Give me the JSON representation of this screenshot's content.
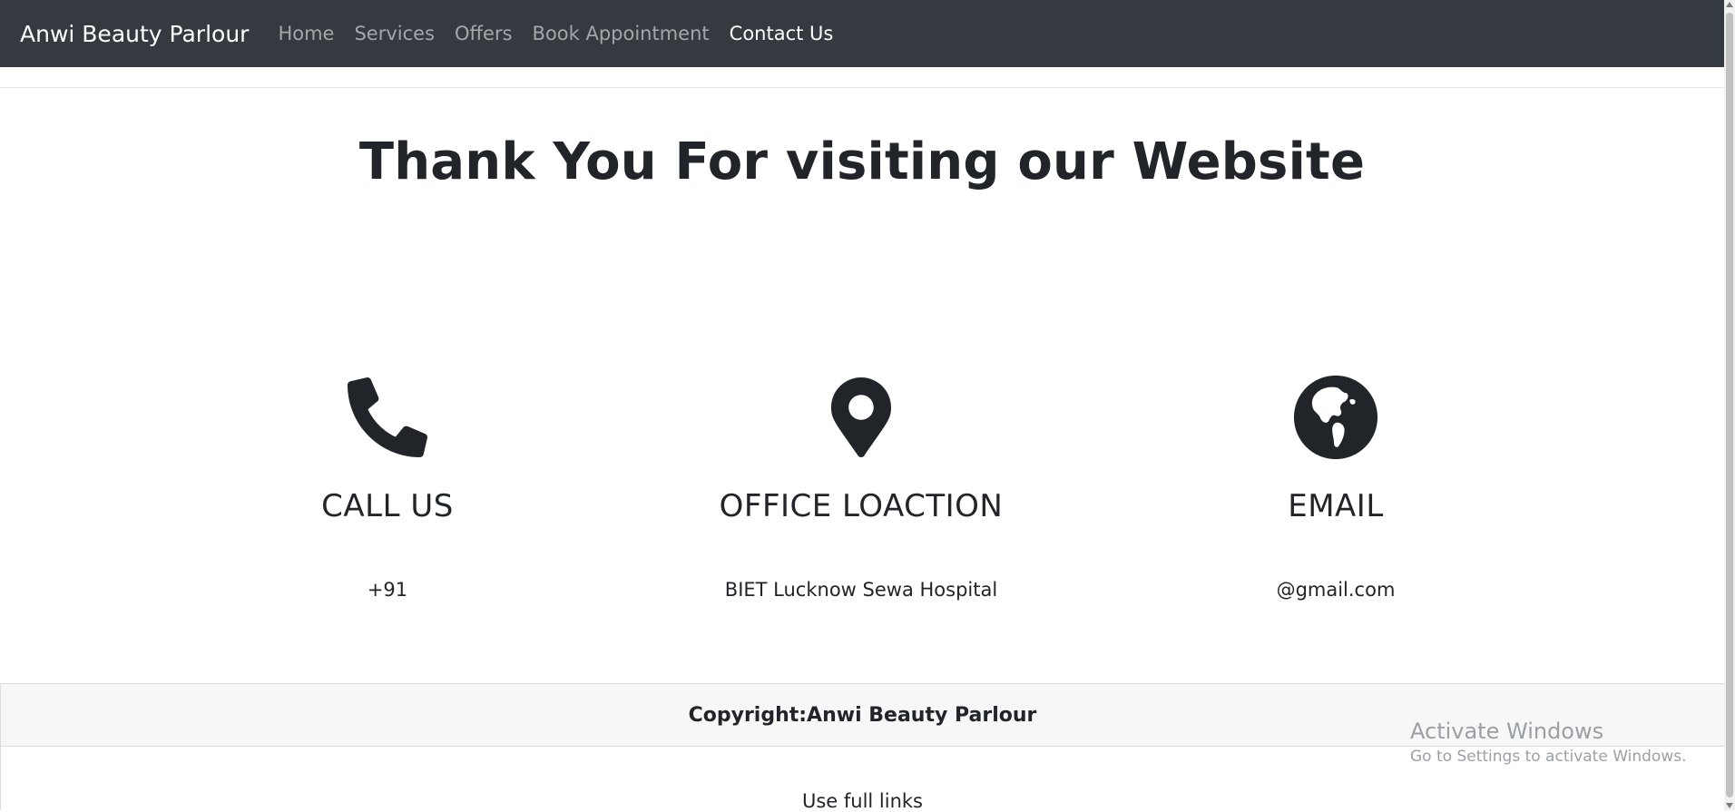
{
  "navbar": {
    "brand": "Anwi Beauty Parlour",
    "links": [
      {
        "label": "Home"
      },
      {
        "label": "Services"
      },
      {
        "label": "Offers"
      },
      {
        "label": "Book Appointment"
      },
      {
        "label": "Contact Us"
      }
    ],
    "active_link": "Contact Us"
  },
  "main": {
    "heading": "Thank You For visiting our Website",
    "contacts": [
      {
        "icon": "phone-icon",
        "title": "CALL US",
        "value": "+91"
      },
      {
        "icon": "location-pin-icon",
        "title": "OFFICE LOACTION",
        "value": "BIET Lucknow Sewa Hospital"
      },
      {
        "icon": "globe-icon",
        "title": "EMAIL",
        "value": "@gmail.com"
      }
    ]
  },
  "footer": {
    "copyright": "Copyright:Anwi Beauty Parlour",
    "useful_links": "Use full links"
  },
  "overlay": {
    "activate_title": "Activate Windows",
    "activate_subtitle": "Go to Settings to activate Windows."
  },
  "colors": {
    "navbar_bg": "#343a40",
    "text": "#212529",
    "nav_link_inactive": "rgba(255,255,255,0.55)",
    "nav_link_active": "#ffffff"
  }
}
